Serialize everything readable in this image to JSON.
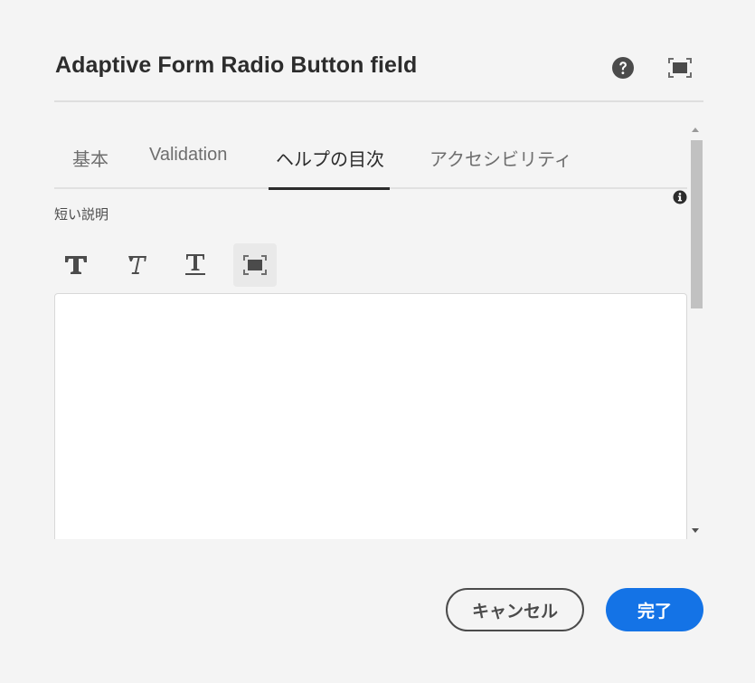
{
  "dialog": {
    "title": "Adaptive Form Radio Button field",
    "help_icon": "help-icon",
    "fullscreen_icon": "fullscreen-icon"
  },
  "tabs": [
    {
      "label": "基本",
      "active": false
    },
    {
      "label": "Validation",
      "active": false
    },
    {
      "label": "ヘルプの目次",
      "active": true
    },
    {
      "label": "アクセシビリティ",
      "active": false
    }
  ],
  "field": {
    "label": "短い説明",
    "info_icon": "info-icon",
    "value": ""
  },
  "toolbar": {
    "bold_icon": "bold-icon",
    "italic_icon": "italic-icon",
    "underline_icon": "underline-icon",
    "expand_icon": "fullscreen-icon"
  },
  "footer": {
    "cancel_label": "キャンセル",
    "done_label": "完了"
  },
  "colors": {
    "primary": "#1473e6",
    "background": "#f4f4f4",
    "text": "#2c2c2c"
  }
}
